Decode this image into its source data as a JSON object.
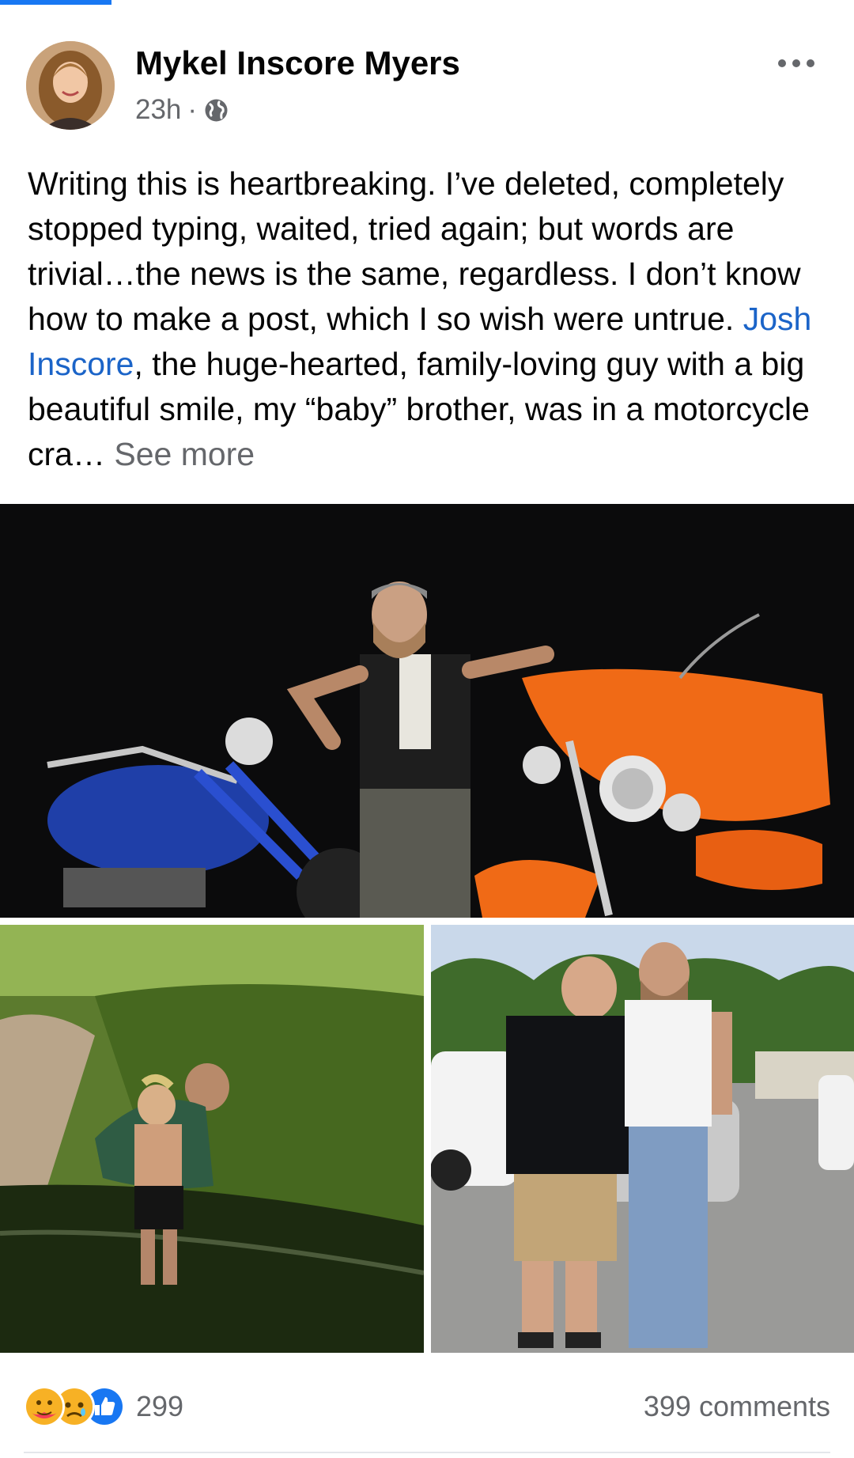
{
  "post": {
    "author": "Mykel Inscore Myers",
    "time": "23h",
    "separator": "·",
    "privacy_icon": "globe-icon",
    "more_icon": "more-horizontal-icon",
    "text_1": "Writing this is heartbreaking. I’ve deleted, completely stopped typing, waited, tried again; but words are trivial…the news is the same, regardless. I don’t know how to make a post, which I so wish were untrue. ",
    "mention": "Josh Inscore",
    "text_2": ",  the huge-hearted, family-loving guy with a big beautiful smile, my “baby” brother, was in a motorcycle cra… ",
    "see_more": "See more"
  },
  "photos": [
    {
      "name": "photo-motorcycles",
      "icon": "photo-icon"
    },
    {
      "name": "photo-creek",
      "icon": "photo-icon"
    },
    {
      "name": "photo-two-men",
      "icon": "photo-icon"
    }
  ],
  "footer": {
    "reaction_icons": [
      "care-icon",
      "sad-icon",
      "like-icon"
    ],
    "reaction_count": "299",
    "comments": "399 comments"
  },
  "colors": {
    "accent": "#1877f2",
    "link": "#1b64c8",
    "muted": "#65676b",
    "like": "#1877f2",
    "sad": "#f7b125"
  }
}
